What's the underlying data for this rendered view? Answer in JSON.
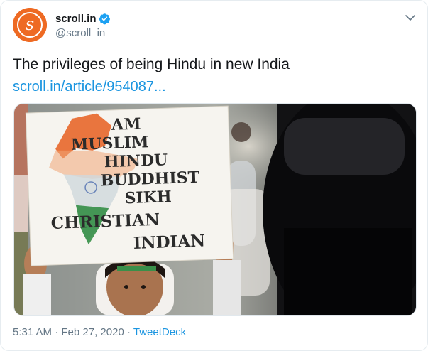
{
  "author": {
    "display_name": "scroll.in",
    "handle": "@scroll_in",
    "avatar_letter": "s",
    "brand_color": "#ee6a23",
    "verified": true
  },
  "tweet": {
    "text": "The privileges of being Hindu in new India",
    "link": "scroll.in/article/954087..."
  },
  "image": {
    "sign_lines": [
      "AM",
      "MUSLIM",
      "HINDU",
      "BUDDHIST",
      "SIKH",
      "CHRISTIAN",
      "INDIAN"
    ]
  },
  "meta": {
    "time": "5:31 AM",
    "separator": "·",
    "date": "Feb 27, 2020",
    "source": "TweetDeck"
  },
  "colors": {
    "link": "#1b95e0",
    "secondary_text": "#657786",
    "verified": "#1da1f2",
    "saffron": "#e8672a",
    "green": "#2a8a3c"
  },
  "icons": [
    "verified-badge-icon",
    "chevron-down-icon"
  ]
}
